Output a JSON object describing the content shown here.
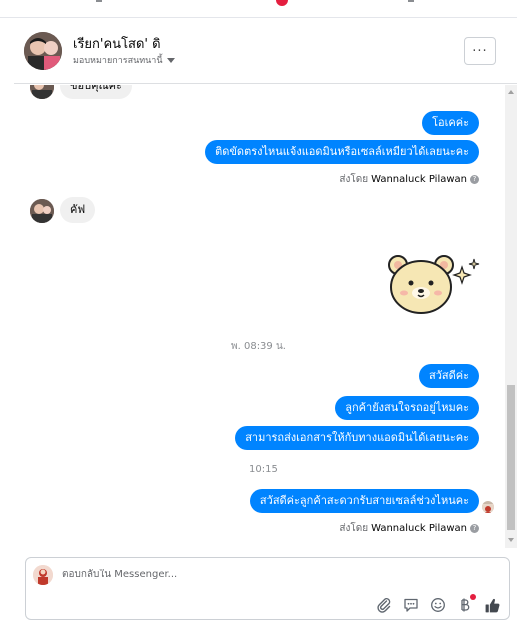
{
  "header": {
    "name": "เรียก'คนโสด' ดิ",
    "subtitle": "มอบหมายการสนทนานี้",
    "more_label": "···"
  },
  "messages": {
    "partial_incoming": "ขอบคุณค่ะ",
    "out_1": "โอเคค่ะ",
    "out_2": "ติดขัดตรงไหนแจ้งแอดมินหรือเซลล์เหมียวได้เลยนะคะ",
    "sent_by_prefix_1": "ส่งโดย",
    "sent_by_name_1": "Wannaluck Pilawan",
    "in_1": "คัฟ",
    "sticker_name": "rilakkuma-bear-sticker",
    "time_separator": "พ. 08:39 น.",
    "out_3": "สวัสดีค่ะ",
    "out_4": "ลูกค้ายังสนใจรถอยู่ไหมคะ",
    "out_5": "สามารถส่งเอกสารให้กับทางแอดมินได้เลยนะคะ",
    "time_small": "10:15",
    "out_6": "สวัสดีค่ะลูกค้าสะดวกรับสายเซลล์ช่วงไหนคะ",
    "sent_by_prefix_2": "ส่งโดย",
    "sent_by_name_2": "Wannaluck Pilawan"
  },
  "composer": {
    "placeholder": "ตอบกลับใน Messenger..."
  },
  "icons": {
    "attach": "paperclip-icon",
    "quick_reply": "chat-bubbles-icon",
    "emoji": "smiley-icon",
    "payment": "baht-icon",
    "like": "thumbs-up-icon"
  },
  "colors": {
    "outgoing_bubble": "#0084ff",
    "incoming_bubble": "#f0f0f0",
    "notification_dot": "#e41e3f"
  }
}
